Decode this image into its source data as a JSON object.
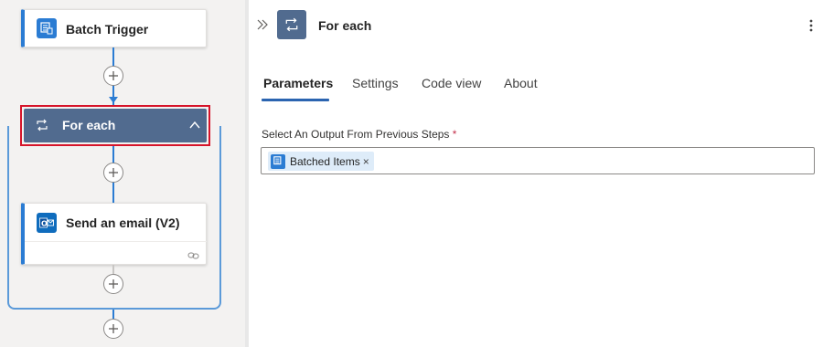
{
  "canvas": {
    "trigger": {
      "title": "Batch Trigger",
      "icon": "batch-trigger-icon"
    },
    "foreach": {
      "title": "For each",
      "icon": "loop-icon",
      "collapse_icon": "chevron-up-icon"
    },
    "email": {
      "title": "Send an email (V2)",
      "icon": "outlook-icon",
      "footer_icon": "link-icon"
    }
  },
  "panel": {
    "expand_icon": "double-chevron-right-icon",
    "header_icon": "loop-icon",
    "title": "For each",
    "more_icon": "more-vertical-icon",
    "tabs": [
      {
        "label": "Parameters",
        "active": true
      },
      {
        "label": "Settings",
        "active": false
      },
      {
        "label": "Code view",
        "active": false
      },
      {
        "label": "About",
        "active": false
      }
    ],
    "field": {
      "label": "Select An Output From Previous Steps",
      "required_mark": "*",
      "token": {
        "label": "Batched Items",
        "remove": "×",
        "icon": "batch-trigger-icon"
      }
    }
  },
  "colors": {
    "accent": "#2b7cd3",
    "loop_header": "#516b8f",
    "selection_border": "#d6142a",
    "tab_underline": "#2b64b0",
    "token_bg": "#deecf9",
    "required": "#c4314b"
  }
}
